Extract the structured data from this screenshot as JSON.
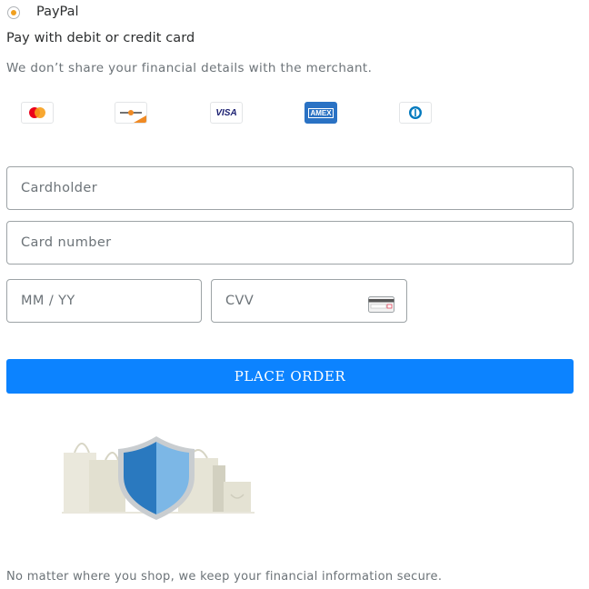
{
  "payment_option": {
    "label": "PayPal",
    "selected": true
  },
  "card_section": {
    "heading": "Pay with debit or credit card",
    "privacy_note": "We don’t share your financial details with the merchant.",
    "card_logos": [
      {
        "name": "mastercard-logo",
        "text": ""
      },
      {
        "name": "discover-logo",
        "text": ""
      },
      {
        "name": "visa-logo",
        "text": "VISA"
      },
      {
        "name": "amex-logo",
        "text": "AMEX"
      },
      {
        "name": "diners-club-logo",
        "text": ""
      }
    ]
  },
  "form": {
    "cardholder_placeholder": "Cardholder",
    "card_number_placeholder": "Card number",
    "expiry_placeholder": "MM / YY",
    "cvv_placeholder": "CVV",
    "cvv_icon": "card-back-icon"
  },
  "actions": {
    "place_order_label": "PLACE ORDER"
  },
  "illustration": {
    "icon": "security-shield-with-shopping-bags"
  },
  "footer": {
    "security_note": "No matter where you shop, we keep your financial information secure."
  },
  "colors": {
    "radio_selected": "#f0a020",
    "button": "#0c83ff",
    "input_border": "#9da3a6",
    "shield_dark": "#2a79bf",
    "shield_light": "#7cb7e6"
  }
}
